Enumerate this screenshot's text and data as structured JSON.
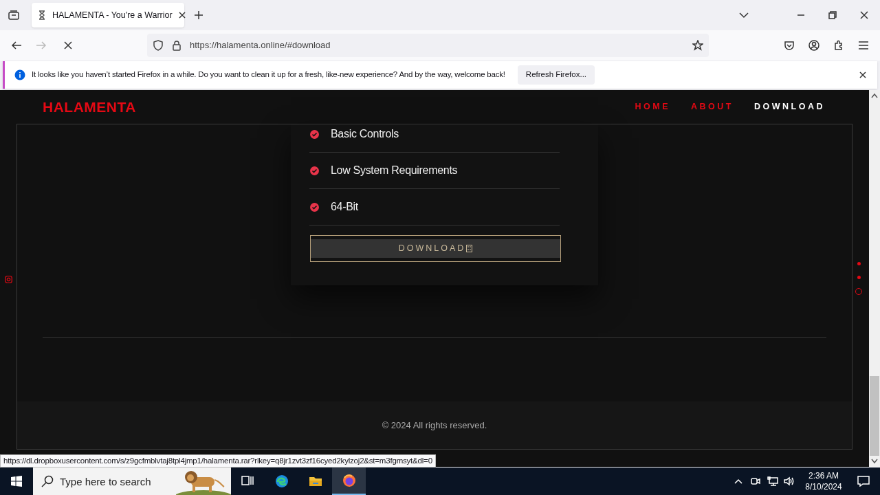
{
  "browser": {
    "tabs": [
      {
        "title": "HALAMENTA - You're a Warrior",
        "selected": true
      }
    ],
    "address": "https://halamenta.online/#download",
    "notification": {
      "message": "It looks like you haven’t started Firefox in a while. Do you want to clean it up for a fresh, like-new experience? And by the way, welcome back!",
      "button": "Refresh Firefox..."
    },
    "status_url": "https://dl.dropboxusercontent.com/s/z9gcfmblvtaj8tpl4jmp1/halamenta.rar?rlkey=q8jr1zvt3zf16cyed2kylzoj2&st=m3fgmsyt&dl=0"
  },
  "site": {
    "logo": "HALAMENTA",
    "nav": [
      {
        "label": "HOME",
        "selected": false
      },
      {
        "label": "ABOUT",
        "selected": false
      },
      {
        "label": "DOWNLOAD",
        "selected": true
      }
    ],
    "features": [
      "Basic Controls",
      "Low System Requirements",
      "64-Bit"
    ],
    "download_button": "DOWNLOAD",
    "section_dots": [
      {
        "selected": false
      },
      {
        "selected": false
      },
      {
        "selected": true
      }
    ],
    "footer": "© 2024 All rights reserved."
  },
  "taskbar": {
    "search": {
      "placeholder": "Type here to search"
    },
    "apps": [
      {
        "kind": "taskview",
        "selected": false
      },
      {
        "kind": "edge",
        "selected": false
      },
      {
        "kind": "explorer",
        "selected": false
      },
      {
        "kind": "firefox",
        "selected": true
      }
    ],
    "time": "2:36 AM",
    "date": "8/10/2024"
  }
}
